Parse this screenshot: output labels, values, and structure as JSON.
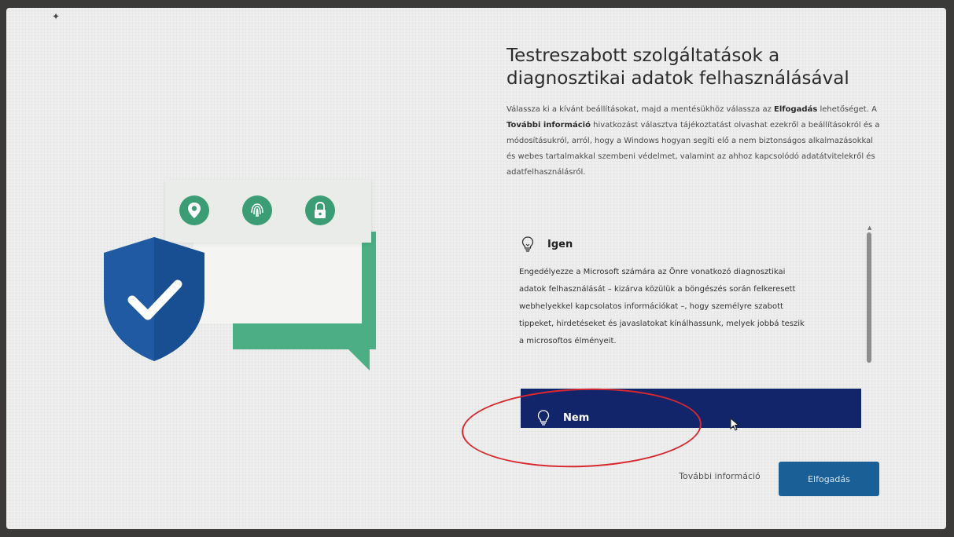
{
  "page": {
    "title": "Testreszabott szolgáltatások a diagnosztikai adatok felhasználásával",
    "intro": {
      "part1": "Válassza ki a kívánt beállításokat, majd a mentésükhöz válassza az ",
      "bold1": "Elfogadás",
      "part2": " lehetőséget. A ",
      "bold2": "További információ",
      "part3": " hivatkozást választva tájékoztatást olvashat ezekről a beállításokról és a módosításukról, arról, hogy a Windows hogyan segíti elő a nem biztonságos alkalmazásokkal és webes tartalmakkal szembeni védelmet, valamint az ahhoz kapcsolódó adatátvitelekről és adatfelhasználásról."
    }
  },
  "options": [
    {
      "label": "Igen",
      "icon": "lightbulb-icon",
      "description": "Engedélyezze a Microsoft számára az Önre vonatkozó diagnosztikai adatok felhasználását – kizárva közülük a böngészés során felkeresett webhelyekkel kapcsolatos információkat –, hogy személyre szabott tippeket, hirdetéseket és javaslatokat kínálhassunk, melyek jobbá teszik a microsoftos élményeit."
    },
    {
      "label": "Nem",
      "icon": "lightbulb-off-icon",
      "selected": true
    }
  ],
  "buttons": {
    "more_info": "További információ",
    "accept": "Elfogadás"
  },
  "illustration_icons": [
    "location-pin-icon",
    "fingerprint-icon",
    "lock-icon",
    "shield-check-icon"
  ],
  "colors": {
    "accent": "#1a5f95",
    "selected_option": "#13256a",
    "green": "#4cae84",
    "shield_blue": "#1f5aa3",
    "annotation_red": "#d8282e"
  }
}
